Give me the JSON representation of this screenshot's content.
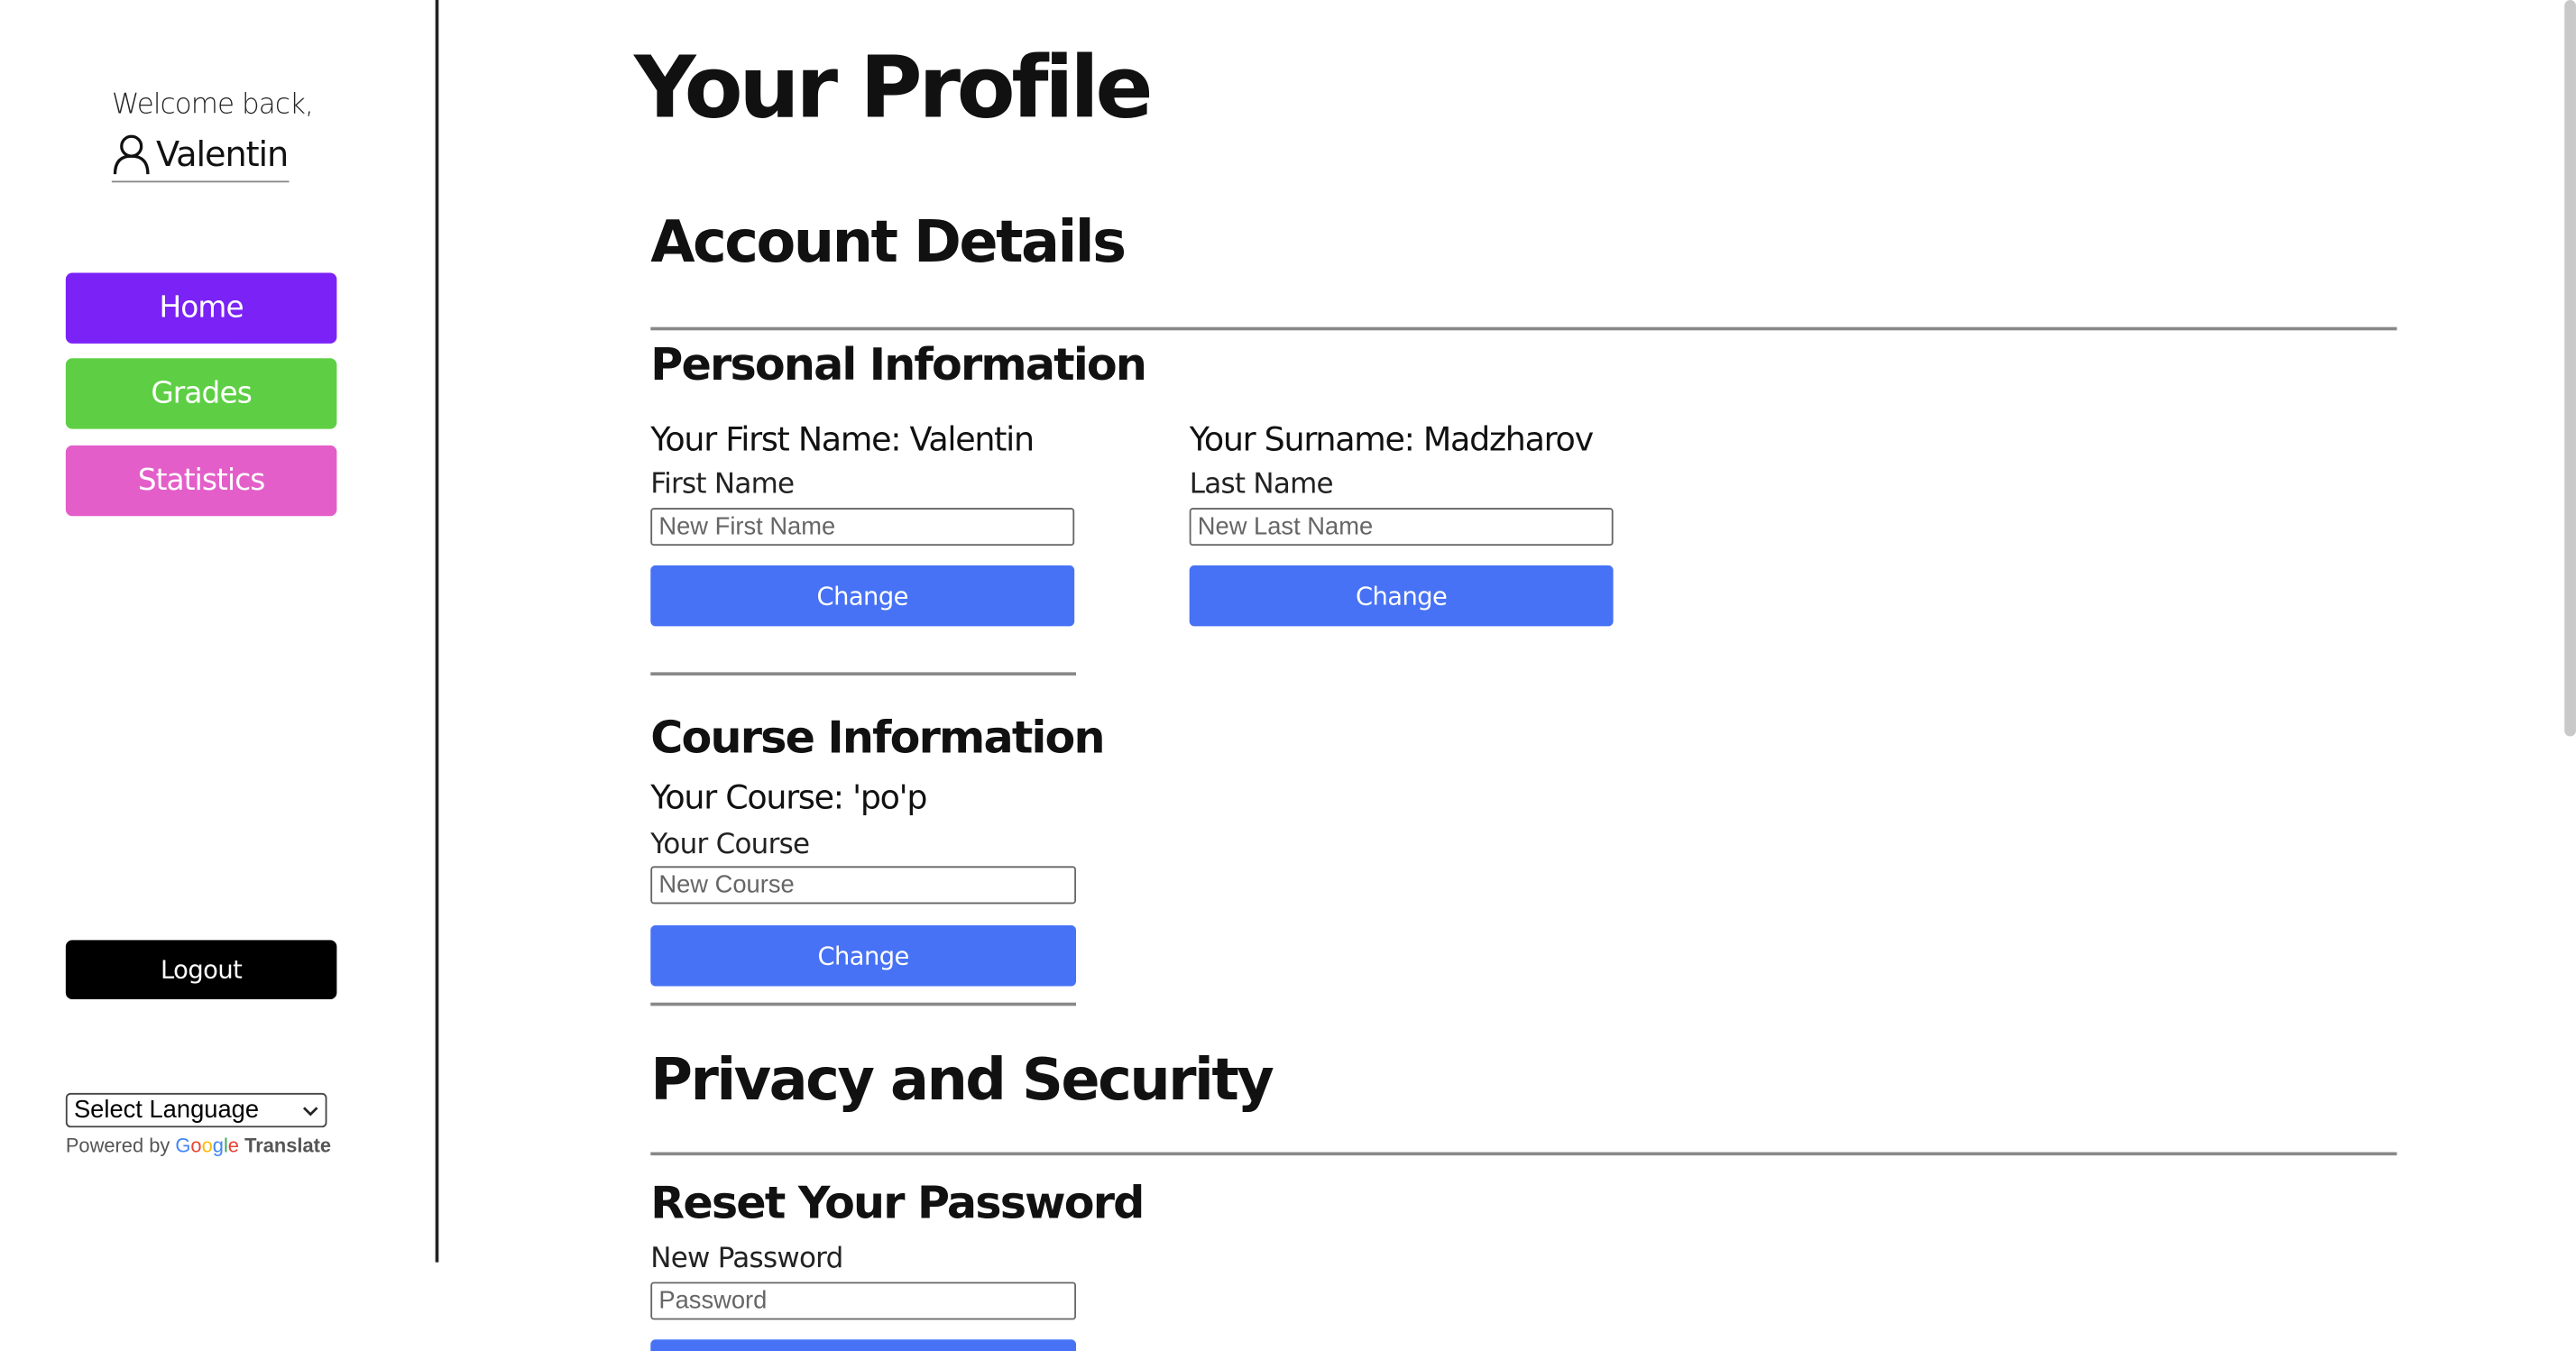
{
  "sidebar": {
    "welcome_text": "Welcome back,",
    "username": "Valentin",
    "nav": [
      {
        "label": "Home",
        "color": "#7b22f7"
      },
      {
        "label": "Grades",
        "color": "#5ecf44"
      },
      {
        "label": "Statistics",
        "color": "#e35ec9"
      }
    ],
    "logout_label": "Logout",
    "language_select": {
      "selected": "Select Language"
    },
    "powered_by": {
      "prefix": "Powered by",
      "brand": "Google",
      "suffix": "Translate"
    }
  },
  "main": {
    "title": "Your Profile",
    "account_details": {
      "heading": "Account Details",
      "personal_information": {
        "heading": "Personal Information",
        "first_name": {
          "current": "Your First Name: Valentin",
          "label": "First Name",
          "placeholder": "New First Name",
          "button": "Change"
        },
        "surname": {
          "current": "Your Surname: Madzharov",
          "label": "Last Name",
          "placeholder": "New Last Name",
          "button": "Change"
        }
      },
      "course_information": {
        "heading": "Course Information",
        "current": "Your Course: 'po'p",
        "label": "Your Course",
        "placeholder": "New Course",
        "button": "Change"
      }
    },
    "privacy_security": {
      "heading": "Privacy and Security",
      "reset_password": {
        "heading": "Reset Your Password",
        "label": "New Password",
        "placeholder": "Password"
      }
    }
  },
  "colors": {
    "accent_button": "#4772f5",
    "logout": "#000000"
  }
}
